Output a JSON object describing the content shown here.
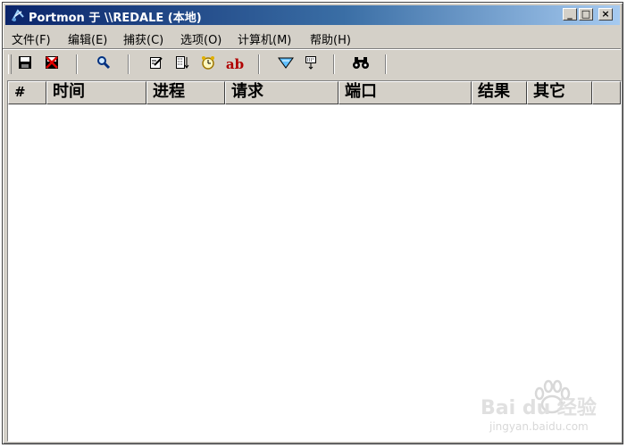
{
  "window": {
    "title": "Portmon 于 \\\\REDALE (本地)",
    "controls": {
      "minimize": "_",
      "maximize": "□",
      "close": "×"
    }
  },
  "menu": [
    {
      "label": "文件(F)"
    },
    {
      "label": "编辑(E)"
    },
    {
      "label": "捕获(C)"
    },
    {
      "label": "选项(O)"
    },
    {
      "label": "计算机(M)"
    },
    {
      "label": "帮助(H)"
    }
  ],
  "toolbar": {
    "icons": [
      "save-icon",
      "clear-icon",
      "magnifier-icon",
      "edit-filter-icon",
      "list-icon",
      "clock-icon",
      "ab-text-icon",
      "capture-icon",
      "highlight-icon",
      "find-binoculars-icon"
    ],
    "ab_label": "ab"
  },
  "table": {
    "columns": [
      "#",
      "时间",
      "进程",
      "请求",
      "端口",
      "结果",
      "其它"
    ],
    "rows": []
  },
  "watermark": {
    "brand": "Bai du 经验",
    "url": "jingyan.baidu.com"
  },
  "colors": {
    "title_start": "#0a246a",
    "title_end": "#a6caf0",
    "face": "#d4d0c8"
  }
}
